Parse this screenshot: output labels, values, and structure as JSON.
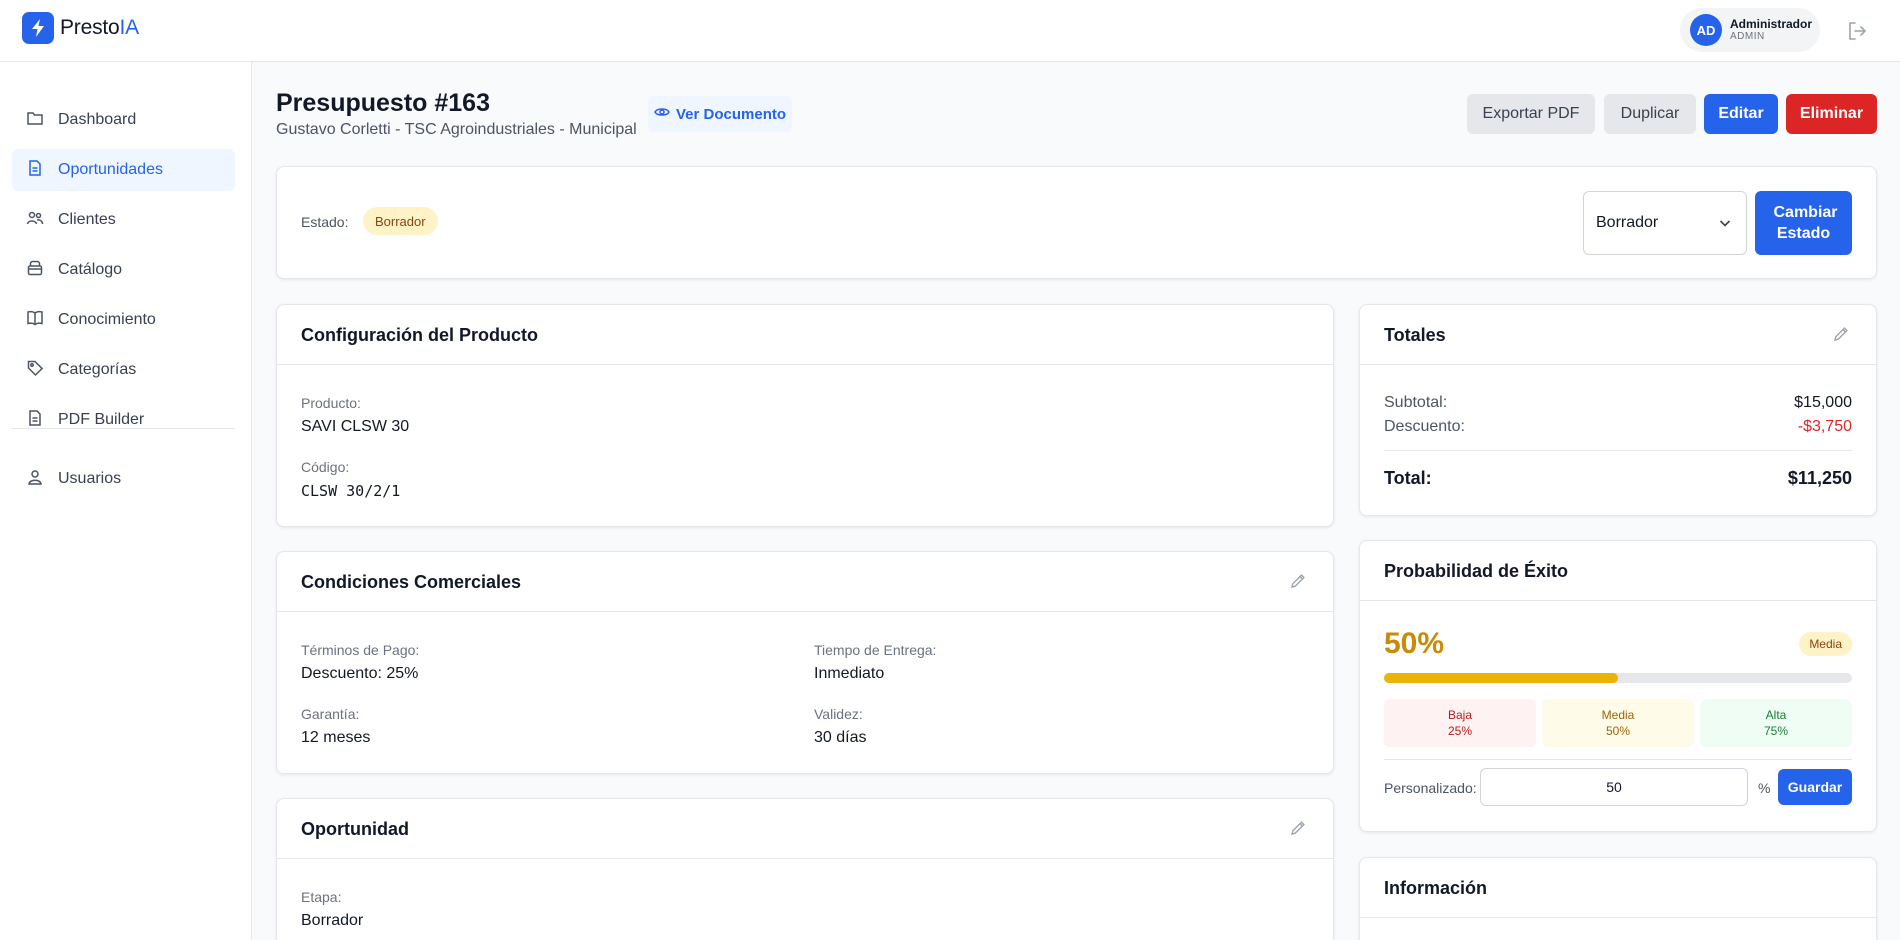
{
  "brand": {
    "prefix": "Presto",
    "accent": "IA"
  },
  "user": {
    "initials": "AD",
    "name": "Administrador",
    "role": "ADMIN"
  },
  "sidebar": {
    "items": [
      {
        "label": "Dashboard",
        "icon": "folder-icon"
      },
      {
        "label": "Oportunidades",
        "icon": "document-icon",
        "active": true
      },
      {
        "label": "Clientes",
        "icon": "users-icon"
      },
      {
        "label": "Catálogo",
        "icon": "box-icon"
      },
      {
        "label": "Conocimiento",
        "icon": "book-icon"
      },
      {
        "label": "Categorías",
        "icon": "tag-icon"
      },
      {
        "label": "PDF Builder",
        "icon": "document-icon"
      },
      {
        "label": "Usuarios",
        "icon": "user-group-icon"
      }
    ]
  },
  "header": {
    "title": "Presupuesto #163",
    "subtitle": "Gustavo Corletti - TSC Agroindustriales - Municipal",
    "view_doc": "Ver Documento",
    "actions": {
      "export": "Exportar PDF",
      "duplicate": "Duplicar",
      "edit": "Editar",
      "delete": "Eliminar"
    }
  },
  "status": {
    "label": "Estado:",
    "badge": "Borrador",
    "select_value": "Borrador",
    "change_button": "Cambiar Estado"
  },
  "product": {
    "title": "Configuración del Producto",
    "product_label": "Producto:",
    "product_value": "SAVI CLSW 30",
    "code_label": "Código:",
    "code_value": "CLSW 30/2/1"
  },
  "conditions": {
    "title": "Condiciones Comerciales",
    "payment_label": "Términos de Pago:",
    "payment_value": "Descuento: 25%",
    "delivery_label": "Tiempo de Entrega:",
    "delivery_value": "Inmediato",
    "warranty_label": "Garantía:",
    "warranty_value": "12 meses",
    "validity_label": "Validez:",
    "validity_value": "30 días"
  },
  "opportunity": {
    "title": "Oportunidad",
    "stage_label": "Etapa:",
    "stage_value": "Borrador"
  },
  "totals": {
    "title": "Totales",
    "subtotal_label": "Subtotal:",
    "subtotal_value": "$15,000",
    "discount_label": "Descuento:",
    "discount_value": "-$3,750",
    "total_label": "Total:",
    "total_value": "$11,250"
  },
  "probability": {
    "title": "Probabilidad de Éxito",
    "percent_text": "50%",
    "level": "Media",
    "fill_fraction": 0.5,
    "options": [
      {
        "name": "Baja",
        "value": "25%"
      },
      {
        "name": "Media",
        "value": "50%"
      },
      {
        "name": "Alta",
        "value": "75%"
      }
    ],
    "custom_label": "Personalizado:",
    "custom_value": "50",
    "custom_unit": "%",
    "save_button": "Guardar"
  },
  "info": {
    "title": "Información"
  },
  "colors": {
    "accent": "#2563eb",
    "danger": "#dc2626",
    "warning": "#ca8a04"
  }
}
